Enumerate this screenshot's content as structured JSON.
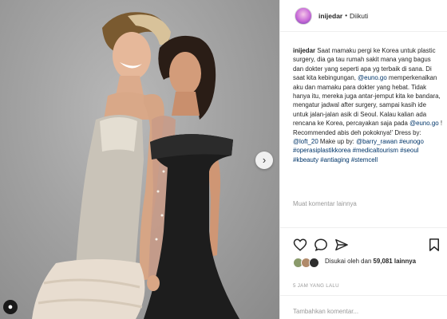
{
  "header": {
    "username": "inijedar",
    "dot": "•",
    "follow_status": "Diikuti"
  },
  "caption": {
    "username": "inijedar",
    "text_1": " Saat mamaku pergi ke Korea untuk plastic surgery, dia ga tau rumah sakit mana yang bagus dan dokter yang seperti apa yg terbaik di sana. Di saat kita kebingungan, ",
    "mention_1": "@euno.go",
    "text_2": " memperkenalkan aku dan mamaku para dokter yang hebat. Tidak hanya itu, mereka juga antar-jemput kita ke bandara, mengatur jadwal after surgery, sampai kasih ide untuk jalan-jalan asik di Seoul. Kalau kalian ada rencana ke Korea, percayakan saja pada ",
    "mention_2": "@euno.go",
    "text_3": " ! Recommended abis deh pokoknya!’ Dress by: ",
    "mention_3": "@loft_20",
    "text_4": " Make up by: ",
    "mention_4": "@barry_rawan",
    "hashtags_1": "#eunogo #operasiplastikkorea #medicaltourism #seoul #kbeauty #antiaging #stemcell"
  },
  "more_comments_label": "Muat komentar lainnya",
  "likes": {
    "prefix": "Disukai oleh",
    "middle": " dan ",
    "count": "59,081 lainnya"
  },
  "timestamp": "5 JAM YANG LALU",
  "comment": {
    "placeholder": "Tambahkan komentar..."
  },
  "icons": {
    "like": "heart-icon",
    "comment": "comment-icon",
    "share": "share-icon",
    "save": "bookmark-icon",
    "next": "chevron-right-icon",
    "tag": "user-tag-icon"
  },
  "colors": {
    "link": "#003569",
    "muted": "#999999",
    "text": "#262626"
  }
}
